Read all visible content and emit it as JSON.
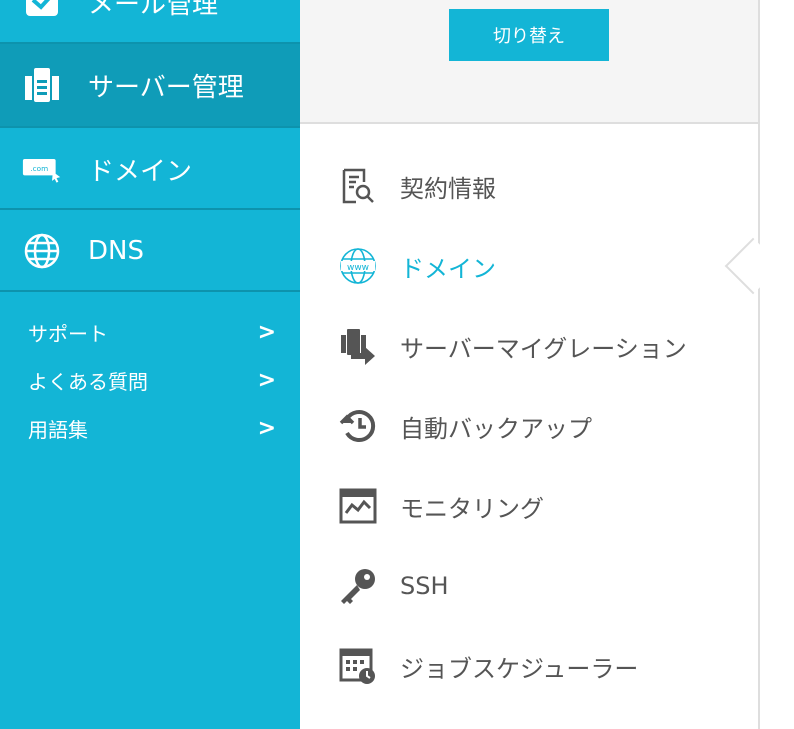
{
  "sidebar": {
    "items": [
      {
        "label": "メール管理",
        "icon": "mail-icon"
      },
      {
        "label": "サーバー管理",
        "icon": "server-icon",
        "active": true
      },
      {
        "label": "ドメイン",
        "icon": "domain-com-icon"
      },
      {
        "label": "DNS",
        "icon": "globe-icon"
      }
    ],
    "links": [
      {
        "label": "サポート"
      },
      {
        "label": "よくある質問"
      },
      {
        "label": "用語集"
      }
    ],
    "chevron": ">"
  },
  "switch_button": {
    "label": "切り替え"
  },
  "menu": {
    "items": [
      {
        "label": "契約情報",
        "icon": "contract-search-icon"
      },
      {
        "label": "ドメイン",
        "icon": "www-globe-icon",
        "active": true
      },
      {
        "label": "サーバーマイグレーション",
        "icon": "server-migration-icon"
      },
      {
        "label": "自動バックアップ",
        "icon": "backup-clock-icon"
      },
      {
        "label": "モニタリング",
        "icon": "monitoring-icon"
      },
      {
        "label": "SSH",
        "icon": "key-icon"
      },
      {
        "label": "ジョブスケジューラー",
        "icon": "scheduler-icon"
      }
    ]
  },
  "colors": {
    "accent": "#13b5d6",
    "active_bg": "#0f9cb8",
    "text": "#555555"
  }
}
